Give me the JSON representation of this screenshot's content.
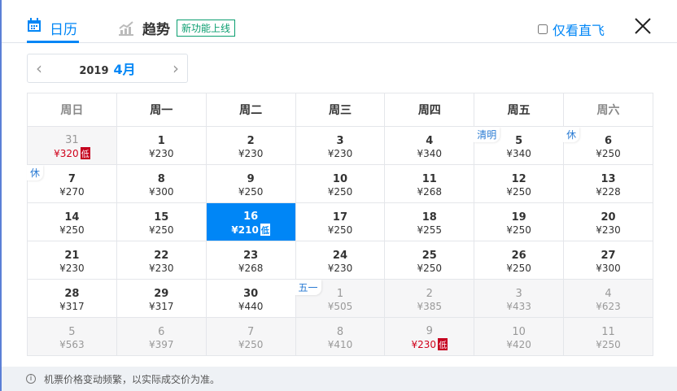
{
  "tabs": {
    "calendar": "日历",
    "trend": "趋势",
    "new_badge": "新功能上线"
  },
  "direct_only": {
    "label": "仅看直飞",
    "checked": false
  },
  "month_nav": {
    "year": "2019",
    "month": "4月"
  },
  "weekdays": [
    "周日",
    "周一",
    "周二",
    "周三",
    "周四",
    "周五",
    "周六"
  ],
  "low_label": "低",
  "colors": {
    "accent": "#0086f6",
    "low": "#d0021b",
    "badge": "#0a9e6f"
  },
  "weeks": [
    [
      {
        "day": "31",
        "price": "¥320",
        "muted": true,
        "low": true
      },
      {
        "day": "1",
        "price": "¥230"
      },
      {
        "day": "2",
        "price": "¥230"
      },
      {
        "day": "3",
        "price": "¥230"
      },
      {
        "day": "4",
        "price": "¥340"
      },
      {
        "day": "5",
        "price": "¥340",
        "tag": "清明"
      },
      {
        "day": "6",
        "price": "¥250",
        "tag": "休"
      }
    ],
    [
      {
        "day": "7",
        "price": "¥270",
        "tag": "休"
      },
      {
        "day": "8",
        "price": "¥300"
      },
      {
        "day": "9",
        "price": "¥250"
      },
      {
        "day": "10",
        "price": "¥250"
      },
      {
        "day": "11",
        "price": "¥268"
      },
      {
        "day": "12",
        "price": "¥250"
      },
      {
        "day": "13",
        "price": "¥228"
      }
    ],
    [
      {
        "day": "14",
        "price": "¥250"
      },
      {
        "day": "15",
        "price": "¥250"
      },
      {
        "day": "16",
        "price": "¥210",
        "low": true,
        "selected": true
      },
      {
        "day": "17",
        "price": "¥250"
      },
      {
        "day": "18",
        "price": "¥255"
      },
      {
        "day": "19",
        "price": "¥250"
      },
      {
        "day": "20",
        "price": "¥230"
      }
    ],
    [
      {
        "day": "21",
        "price": "¥230"
      },
      {
        "day": "22",
        "price": "¥230"
      },
      {
        "day": "23",
        "price": "¥268"
      },
      {
        "day": "24",
        "price": "¥230"
      },
      {
        "day": "25",
        "price": "¥250"
      },
      {
        "day": "26",
        "price": "¥250"
      },
      {
        "day": "27",
        "price": "¥300"
      }
    ],
    [
      {
        "day": "28",
        "price": "¥317"
      },
      {
        "day": "29",
        "price": "¥317"
      },
      {
        "day": "30",
        "price": "¥440"
      },
      {
        "day": "1",
        "price": "¥505",
        "muted": true,
        "tag": "五一"
      },
      {
        "day": "2",
        "price": "¥385",
        "muted": true
      },
      {
        "day": "3",
        "price": "¥433",
        "muted": true
      },
      {
        "day": "4",
        "price": "¥623",
        "muted": true
      }
    ],
    [
      {
        "day": "5",
        "price": "¥563",
        "muted": true
      },
      {
        "day": "6",
        "price": "¥397",
        "muted": true
      },
      {
        "day": "7",
        "price": "¥250",
        "muted": true
      },
      {
        "day": "8",
        "price": "¥410",
        "muted": true
      },
      {
        "day": "9",
        "price": "¥230",
        "muted": true,
        "low": true
      },
      {
        "day": "10",
        "price": "¥420",
        "muted": true
      },
      {
        "day": "11",
        "price": "¥250",
        "muted": true
      }
    ]
  ],
  "footer": {
    "icon": "info-icon",
    "note": "机票价格变动频繁，以实际成交价为准。"
  }
}
